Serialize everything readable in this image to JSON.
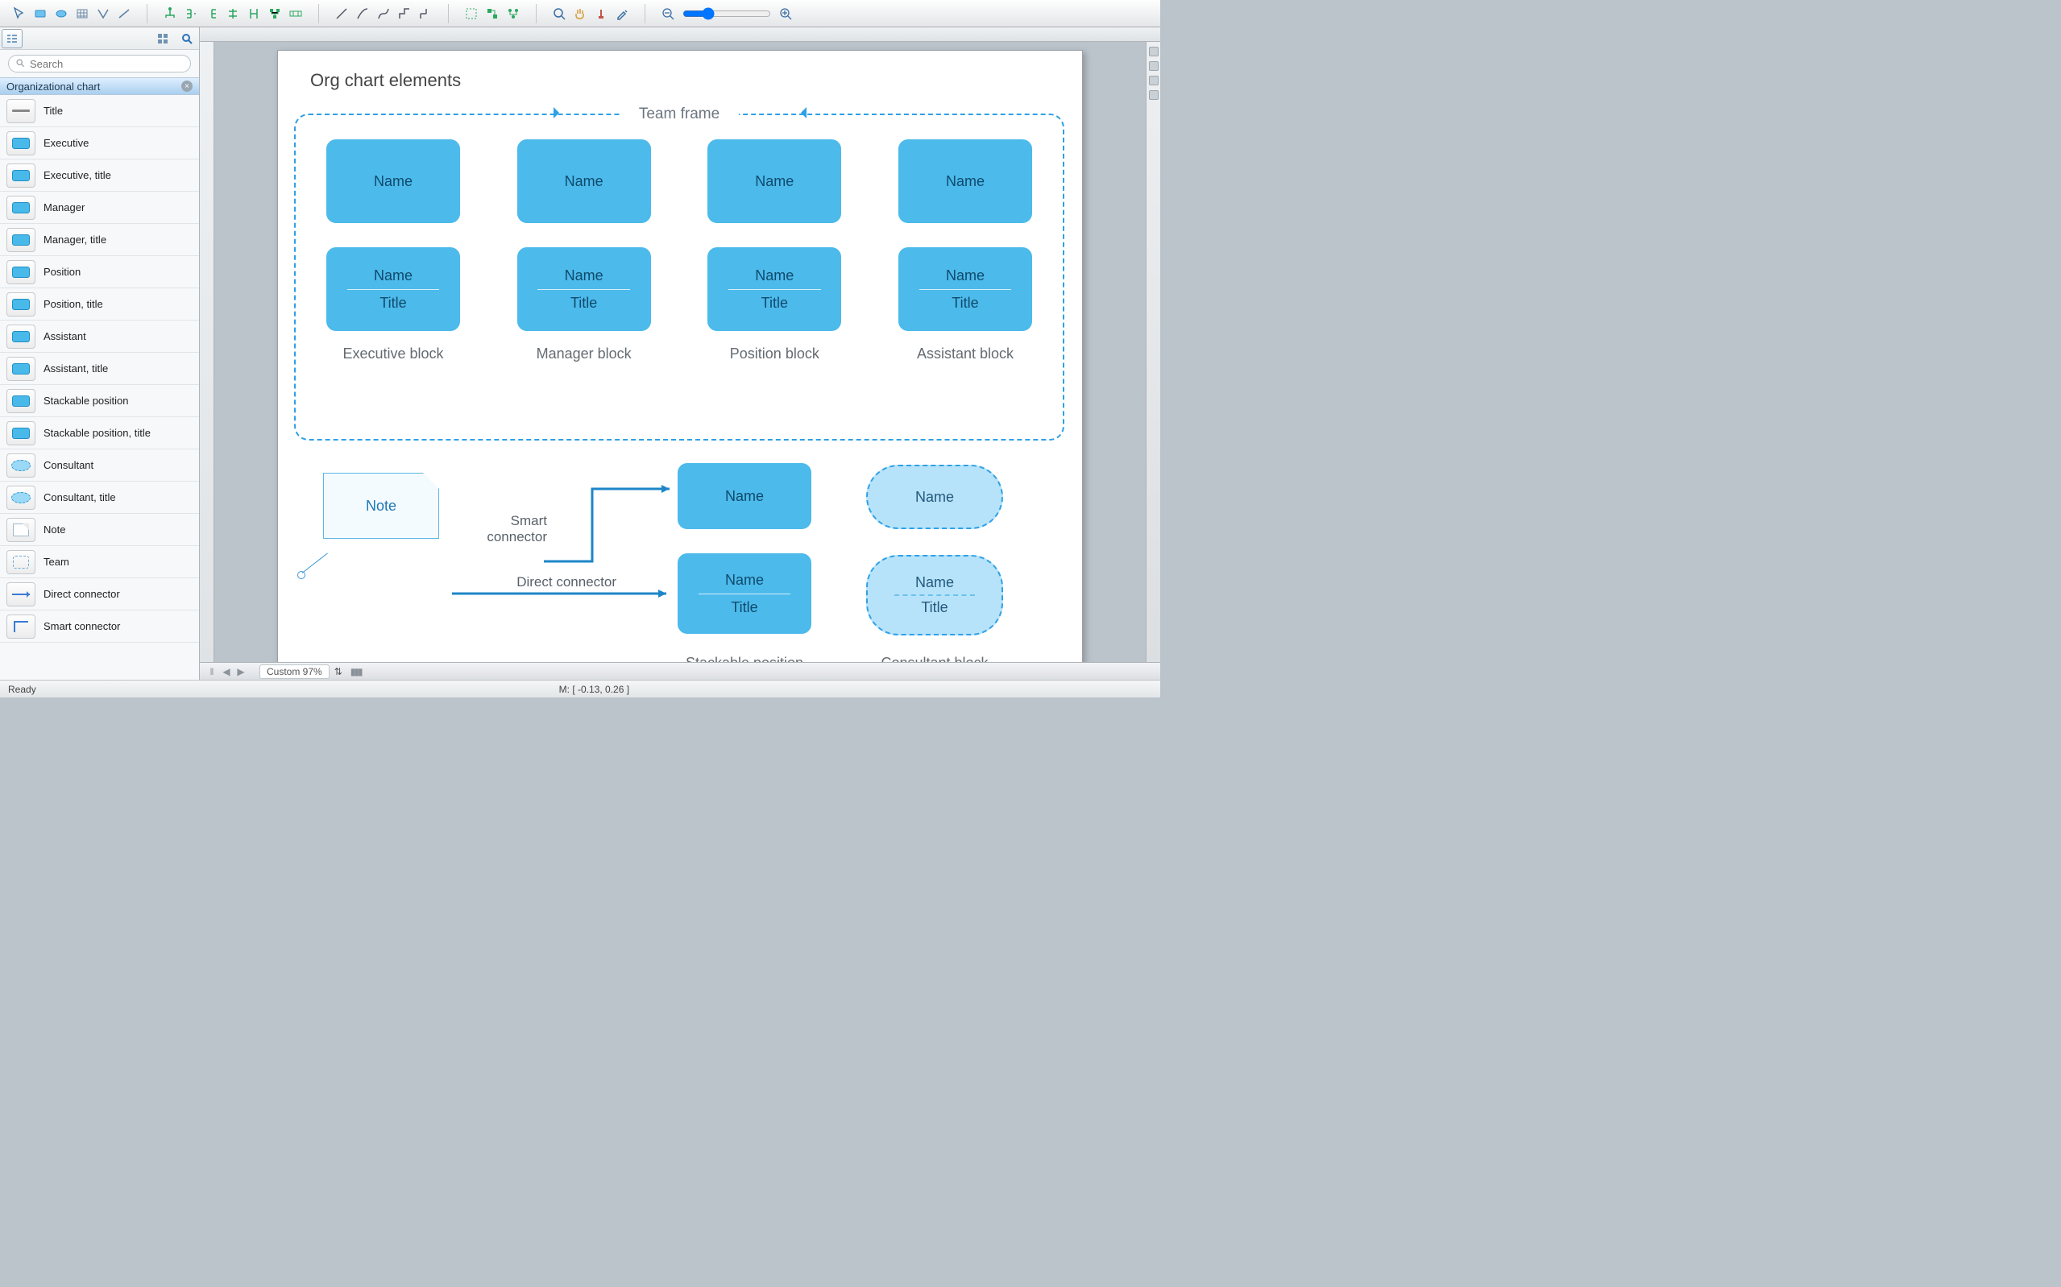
{
  "search_placeholder": "Search",
  "section_title": "Organizational chart",
  "stencils": [
    {
      "label": "Title",
      "kind": "title"
    },
    {
      "label": "Executive",
      "kind": "rect"
    },
    {
      "label": "Executive, title",
      "kind": "rect"
    },
    {
      "label": "Manager",
      "kind": "rect"
    },
    {
      "label": "Manager, title",
      "kind": "rect"
    },
    {
      "label": "Position",
      "kind": "rect"
    },
    {
      "label": "Position, title",
      "kind": "rect"
    },
    {
      "label": "Assistant",
      "kind": "rect"
    },
    {
      "label": "Assistant, title",
      "kind": "rect"
    },
    {
      "label": "Stackable position",
      "kind": "rect"
    },
    {
      "label": "Stackable position, title",
      "kind": "rect"
    },
    {
      "label": "Consultant",
      "kind": "ellipse"
    },
    {
      "label": "Consultant, title",
      "kind": "ellipse"
    },
    {
      "label": "Note",
      "kind": "note"
    },
    {
      "label": "Team",
      "kind": "team"
    },
    {
      "label": "Direct connector",
      "kind": "arr"
    },
    {
      "label": "Smart connector",
      "kind": "smart"
    }
  ],
  "canvas": {
    "title": "Org chart elements",
    "team_frame_label": "Team frame",
    "block_text_name": "Name",
    "block_text_title": "Title",
    "col_labels": [
      "Executive block",
      "Manager block",
      "Position block",
      "Assistant block"
    ],
    "note_text": "Note",
    "smart_conn_label": "Smart connector",
    "direct_conn_label": "Direct connector",
    "stackable_label": "Stackable position block",
    "consultant_label": "Consultant block"
  },
  "status": {
    "ready": "Ready",
    "zoom": "Custom 97%",
    "mouse": "M: [ -0.13, 0.26 ]"
  }
}
